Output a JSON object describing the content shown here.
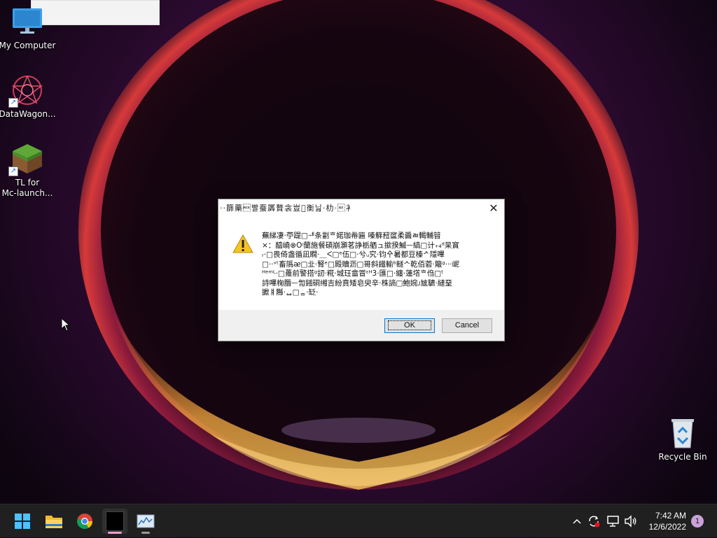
{
  "desktop": {
    "icons": [
      {
        "label": "My Computer",
        "icon": "monitor-icon"
      },
      {
        "label": "DataWagon...",
        "icon": "datawagon-app-icon"
      },
      {
        "label": "TL for\nMc-launch...",
        "icon": "minecraft-grass-block-icon"
      },
      {
        "label": "Recycle Bin",
        "icon": "recycle-bin-icon"
      }
    ]
  },
  "dialog": {
    "title": "··篩藥\u0006빨蚕羼贅衾豈\u0000衡닖·朸·\u001d衤",
    "message": "蕪綈凄·䀡蒰\u001e\u0000衊翕館\u0005婚珈衶匾\u0000瞭䗲鑓篩\u0000\u0000暦\u0000\u0000\u0000\u0000\u0000\u0000䭧\u0000\u0000×：醯嶢\u0000\u0000萠䪼\u0000\u0000\u0000\u0000崩灢\u0000\u0000\u0000\u0000\u0000\u0000\u0000\u0000\u0000\u0000\u0000\u0000\u0000\u0000\u0000\u0000\u0000\u0000\u0000\u0000\u0000\u0000\u0000\u0000\u0000\u0000\u0000\u0000\u0000\u0000\u0000\u0000\u0000\u0000\u0000\u0000\u0000\u0000\u0000\u0000\u0000\u0000\u0000",
    "message_lines": [
      "蕪綈凄·苧踶□ᆁ条劏ᄒ婼珈帣匾 嗪䉳䂇䆰柔醬ㄼ輵輔暜",
      "×：醯嶢⊗Oᵎ蘭施餐碩崩灝茗諍栃舾ュ撳揆鰄ᅳ縞□计₊₄ᵈ杲䆬",
      "ᵣ·□畏倚盏循凪瞯·＿ᐸ□ᵉ伍□·兮ᵤ究·钧㐃暑都豆榛ᄼ隱嗶",
      "□··ᵛᵗ畜䧦ᴂ□㐀·腎ᵉ□殿贖沥□哥斜鐵輸ᵇ䡵ᄉ乾佰菪·簸ᵍ···㞾",
      "ᴴᵉᵐᴸ·□躉前警搭ᵍ訒·糀·城玨畲冒ᵋᴴ3·匯□·纏·蓮㙮ᄒ㑇□ᵗ",
      "詩嗶椈䐶ᅳ訇鎺硐缃吉紛賁矮皂臾辛·株謪□鮑婉ᴊ㝿䮽·縺堊",
      "擨ㅒ䧰·ᆸ□ᇂ·䍇·"
    ],
    "ok_label": "OK",
    "cancel_label": "Cancel",
    "close_icon": "close-icon",
    "warning_icon": "warning-icon"
  },
  "taskbar": {
    "items": [
      "start-icon",
      "file-explorer-icon",
      "chrome-icon",
      "terminal-icon",
      "resource-monitor-icon"
    ],
    "tray": [
      "chevron-up-icon",
      "sync-icon",
      "network-icon",
      "volume-icon"
    ],
    "time": "7:42 AM",
    "date": "12/6/2022",
    "notification_count": "1"
  }
}
